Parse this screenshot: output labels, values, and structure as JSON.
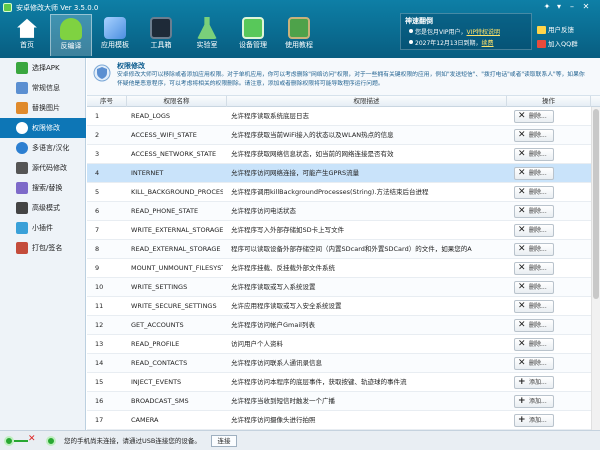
{
  "window": {
    "title": "安卓修改大师 Ver 3.5.0.0"
  },
  "toolbar": {
    "items": [
      {
        "label": "首页",
        "icon": "home-icon",
        "color": "#ffffff"
      },
      {
        "label": "反编译",
        "icon": "android-icon",
        "color": "#7fd241"
      },
      {
        "label": "应用模板",
        "icon": "template-icon",
        "color": "#7fb6ff"
      },
      {
        "label": "工具箱",
        "icon": "toolbox-icon",
        "color": "#1e2a38"
      },
      {
        "label": "实验室",
        "icon": "flask-icon",
        "color": "#7ad07a"
      },
      {
        "label": "设备管理",
        "icon": "device-icon",
        "color": "#58c85a"
      },
      {
        "label": "使用教程",
        "icon": "book-icon",
        "color": "#4ea24a"
      }
    ],
    "active_index": 1
  },
  "vip": {
    "title": "神速翻倒",
    "line1_prefix": "您是包月VIP用户，",
    "line1_link": "VIP特权说明",
    "line2_prefix": "2027年12月13日到期，",
    "line2_link": "续费",
    "feedback": "用户反馈",
    "qq": "加入QQ群"
  },
  "leftnav": {
    "items": [
      {
        "label": "选择APK",
        "icon": "apk-icon",
        "color": "#3aa63f"
      },
      {
        "label": "常规信息",
        "icon": "info-icon",
        "color": "#5b8fd1"
      },
      {
        "label": "替换图片",
        "icon": "image-icon",
        "color": "#e08a2c"
      },
      {
        "label": "权限修改",
        "icon": "permission-icon",
        "color": "#ffffff"
      },
      {
        "label": "多语言/汉化",
        "icon": "language-icon",
        "color": "#2c7fd1"
      },
      {
        "label": "源代码修改",
        "icon": "code-icon",
        "color": "#555555"
      },
      {
        "label": "搜索/替换",
        "icon": "search-icon",
        "color": "#7e6ac9"
      },
      {
        "label": "高级模式",
        "icon": "advanced-icon",
        "color": "#444444"
      },
      {
        "label": "小插件",
        "icon": "plugin-icon",
        "color": "#3aa0d8"
      },
      {
        "label": "打包/签名",
        "icon": "package-icon",
        "color": "#c44c3b"
      }
    ],
    "active_index": 3
  },
  "info": {
    "title": "权限修改",
    "desc": "安卓修改大师可以移除或者添加应用权限。对于单机应用，你可以考虑删除\"网络访问\"权限，对于一些拥有关键权限的应用，例如\"发送短信\"、\"拨打电话\"或者\"读取联系人\"等，如果你怀疑他是恶意程序，可以考虑将相关的权限删除。请注意，添加或者删除权限将可能导致程序运行问题。"
  },
  "table": {
    "headers": [
      "序号",
      "权限名称",
      "权限描述",
      "操作"
    ],
    "selected_index": 3,
    "rows": [
      {
        "num": "1",
        "name": "READ_LOGS",
        "desc": "允许程序读取系统底层日志",
        "action": "删除..."
      },
      {
        "num": "2",
        "name": "ACCESS_WIFI_STATE",
        "desc": "允许程序获取当前WiFi接入的状态以及WLAN热点的信息",
        "action": "删除..."
      },
      {
        "num": "3",
        "name": "ACCESS_NETWORK_STATE",
        "desc": "允许程序获取网络信息状态，如当前的网络连接是否有效",
        "action": "删除..."
      },
      {
        "num": "4",
        "name": "INTERNET",
        "desc": "允许程序访问网络连接，可能产生GPRS流量",
        "action": "删除..."
      },
      {
        "num": "5",
        "name": "KILL_BACKGROUND_PROCESSES",
        "desc": "允许程序调用killBackgroundProcesses(String).方法结束后台进程",
        "action": "删除..."
      },
      {
        "num": "6",
        "name": "READ_PHONE_STATE",
        "desc": "允许程序访问电话状态",
        "action": "删除..."
      },
      {
        "num": "7",
        "name": "WRITE_EXTERNAL_STORAGE",
        "desc": "允许程序写入外部存储如SD卡上写文件",
        "action": "删除..."
      },
      {
        "num": "8",
        "name": "READ_EXTERNAL_STORAGE",
        "desc": "程序可以读取设备外部存储空间（内置SDcard和外置SDCard）的文件，如果您的A",
        "action": "删除..."
      },
      {
        "num": "9",
        "name": "MOUNT_UNMOUNT_FILESYSTEMS",
        "desc": "允许程序挂载、反挂载外部文件系统",
        "action": "删除..."
      },
      {
        "num": "10",
        "name": "WRITE_SETTINGS",
        "desc": "允许程序读取或写入系统设置",
        "action": "删除..."
      },
      {
        "num": "11",
        "name": "WRITE_SECURE_SETTINGS",
        "desc": "允许应用程序读取或写入安全系统设置",
        "action": "删除..."
      },
      {
        "num": "12",
        "name": "GET_ACCOUNTS",
        "desc": "允许程序访问帐户Gmail列表",
        "action": "删除..."
      },
      {
        "num": "13",
        "name": "READ_PROFILE",
        "desc": "访问用户个人资料",
        "action": "删除..."
      },
      {
        "num": "14",
        "name": "READ_CONTACTS",
        "desc": "允许程序访问联系人通讯录信息",
        "action": "删除..."
      },
      {
        "num": "15",
        "name": "INJECT_EVENTS",
        "desc": "允许程序访问本程序的底层事件，获取按键、轨迹球的事件流",
        "action": "添加..."
      },
      {
        "num": "16",
        "name": "BROADCAST_SMS",
        "desc": "允许程序当收到短信时触发一个广播",
        "action": "添加..."
      },
      {
        "num": "17",
        "name": "CAMERA",
        "desc": "允许程序访问摄像头进行拍照",
        "action": "添加..."
      }
    ]
  },
  "status": {
    "text": "您的手机尚未连接，请通过USB连接您的设备。",
    "connect_button": "连接"
  }
}
